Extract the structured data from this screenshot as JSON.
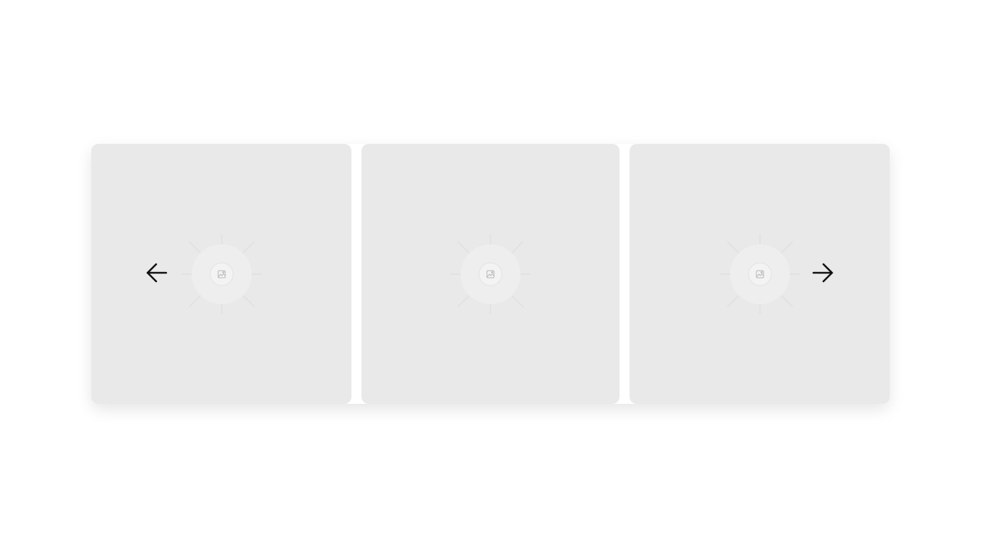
{
  "carousel": {
    "slides": [
      {
        "image_icon": "image-placeholder-icon"
      },
      {
        "image_icon": "image-placeholder-icon"
      },
      {
        "image_icon": "image-placeholder-icon"
      }
    ],
    "prev_icon": "arrow-left-icon",
    "next_icon": "arrow-right-icon"
  },
  "colors": {
    "page_background": "#ffffff",
    "slide_background": "#e9e9e9",
    "arrow": "#111111",
    "placeholder_stroke": "#b5b5b5"
  }
}
